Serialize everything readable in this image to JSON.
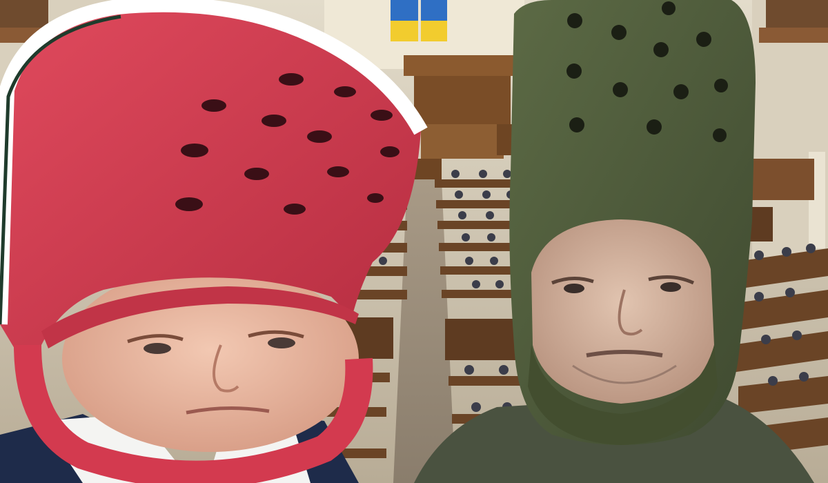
{
  "scene": {
    "setting": "parliament-chamber",
    "flag_colors": {
      "top": "#2f6fc4",
      "bottom": "#f2cc2e"
    },
    "figures": [
      {
        "name": "left-figure",
        "headwear": "clog-shaped-helmet",
        "headwear_color": "#d33a4f",
        "strap_color": "#ffffff",
        "shirt_color": "#1e2b4a"
      },
      {
        "name": "right-figure",
        "headwear": "clog-shaped-hood",
        "headwear_color": "#4e5a39",
        "clothing_color": "#4a5240"
      }
    ]
  }
}
